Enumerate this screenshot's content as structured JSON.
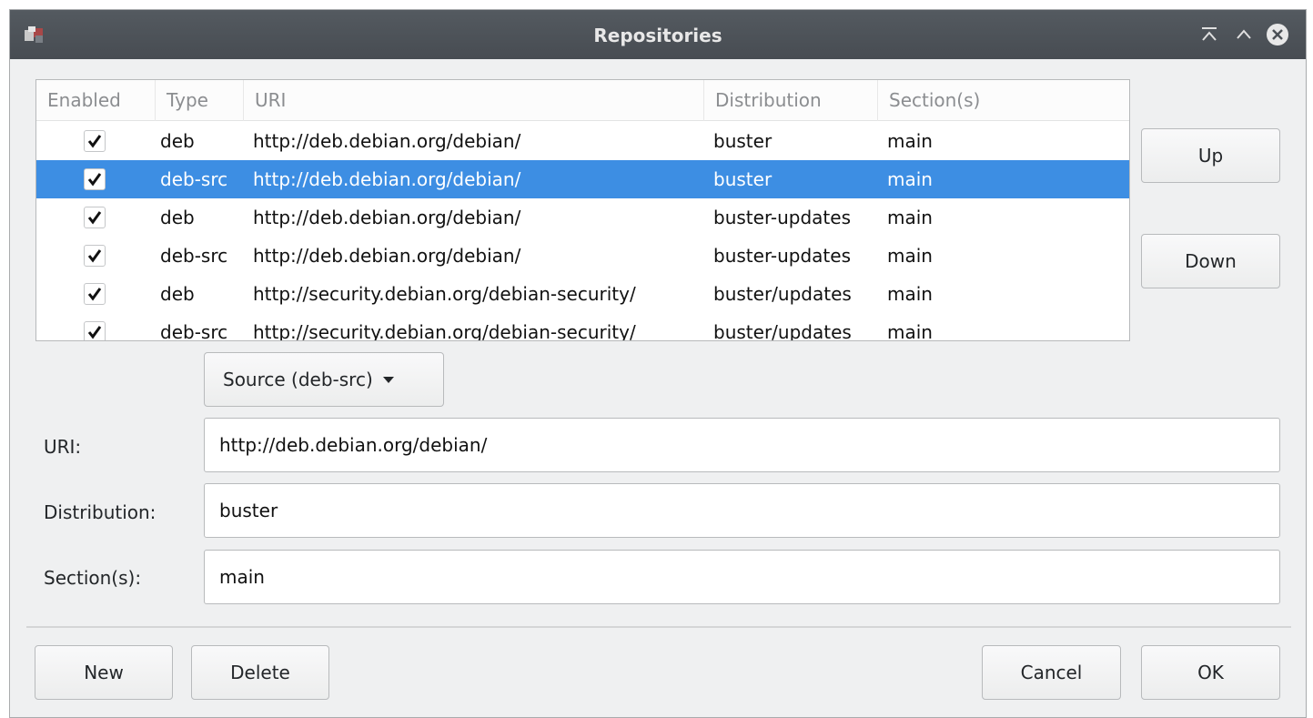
{
  "window": {
    "title": "Repositories"
  },
  "table": {
    "headers": {
      "enabled": "Enabled",
      "type": "Type",
      "uri": "URI",
      "distribution": "Distribution",
      "sections": "Section(s)"
    },
    "rows": [
      {
        "enabled": true,
        "type": "deb",
        "uri": "http://deb.debian.org/debian/",
        "distribution": "buster",
        "sections": "main"
      },
      {
        "enabled": true,
        "type": "deb-src",
        "uri": "http://deb.debian.org/debian/",
        "distribution": "buster",
        "sections": "main",
        "selected": true
      },
      {
        "enabled": true,
        "type": "deb",
        "uri": "http://deb.debian.org/debian/",
        "distribution": "buster-updates",
        "sections": "main"
      },
      {
        "enabled": true,
        "type": "deb-src",
        "uri": "http://deb.debian.org/debian/",
        "distribution": "buster-updates",
        "sections": "main"
      },
      {
        "enabled": true,
        "type": "deb",
        "uri": "http://security.debian.org/debian-security/",
        "distribution": "buster/updates",
        "sections": "main"
      },
      {
        "enabled": true,
        "type": "deb-src",
        "uri": "http://security.debian.org/debian-security/",
        "distribution": "buster/updates",
        "sections": "main"
      }
    ]
  },
  "side_buttons": {
    "up": "Up",
    "down": "Down"
  },
  "type_select": {
    "value": "Source (deb-src)"
  },
  "form": {
    "uri_label": "URI:",
    "uri_value": "http://deb.debian.org/debian/",
    "distribution_label": "Distribution:",
    "distribution_value": "buster",
    "sections_label": "Section(s):",
    "sections_value": "main"
  },
  "footer": {
    "new": "New",
    "delete": "Delete",
    "cancel": "Cancel",
    "ok": "OK"
  },
  "colors": {
    "selection": "#3d8ee3",
    "titlebar": "#4b5056"
  }
}
